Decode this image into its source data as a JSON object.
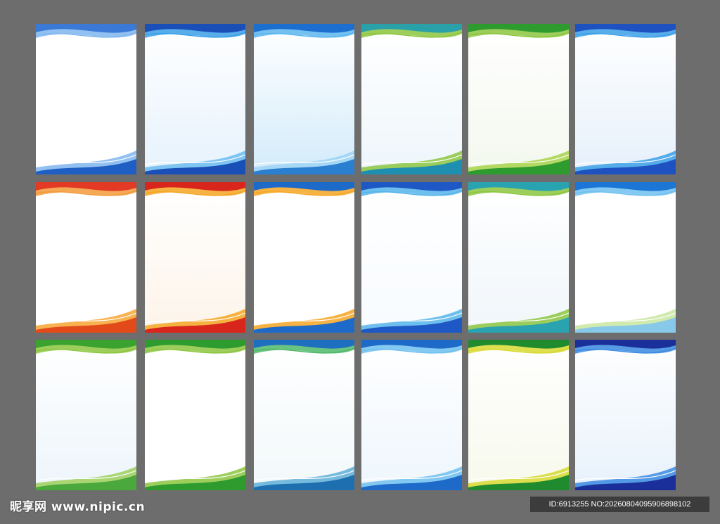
{
  "watermark": {
    "text": "昵享网 www.nipic.cn"
  },
  "id_label": {
    "text": "ID:6913255 NO:20260804095906898102"
  },
  "templates": [
    {
      "top": "#3a7ad6",
      "top2": "#7fb6ee",
      "bottom": "#1f5fc4",
      "bottom2": "#7fb6ee",
      "bg": "#ffffff"
    },
    {
      "top": "#1a4fb8",
      "top2": "#3aa0e8",
      "bottom": "#1a4fb8",
      "bottom2": "#6bbcf0",
      "bg": "#e6f2fc"
    },
    {
      "top": "#1d6fcf",
      "top2": "#5cb6ee",
      "bottom": "#2a7fd0",
      "bottom2": "#9ed3f5",
      "bg": "#d3ebfa"
    },
    {
      "top": "#2aa0a8",
      "top2": "#8cc63f",
      "bottom": "#1e8fb0",
      "bottom2": "#8cc63f",
      "bg": "#eef6fb"
    },
    {
      "top": "#2e9b2e",
      "top2": "#8cc63f",
      "bottom": "#2e9b2e",
      "bottom2": "#a7d44a",
      "bg": "#f3f8ee"
    },
    {
      "top": "#1e52c0",
      "top2": "#3aa0e8",
      "bottom": "#1e52c0",
      "bottom2": "#3aa0e8",
      "bg": "#e6f0fb"
    },
    {
      "top": "#e23a24",
      "top2": "#f39a3a",
      "bottom": "#e24a1a",
      "bottom2": "#f7a531",
      "bg": "#ffffff"
    },
    {
      "top": "#d8261c",
      "top2": "#f5a623",
      "bottom": "#d8261c",
      "bottom2": "#f5a623",
      "bg": "#fdf4ea"
    },
    {
      "top": "#1d6ac9",
      "top2": "#f5a623",
      "bottom": "#1d6ac9",
      "bottom2": "#f5a623",
      "bg": "#ffffff"
    },
    {
      "top": "#1e58c4",
      "top2": "#55b4ea",
      "bottom": "#1e58c4",
      "bottom2": "#55b4ea",
      "bg": "#f7fbff"
    },
    {
      "top": "#2aa3b0",
      "top2": "#8cc63f",
      "bottom": "#2aa3b0",
      "bottom2": "#8cc63f",
      "bg": "#f0f6fa"
    },
    {
      "top": "#1b76d6",
      "top2": "#6ec0ef",
      "bottom": "#88c8e8",
      "bottom2": "#c9e6a0",
      "bg": "#ffffff"
    },
    {
      "top": "#3aa22e",
      "top2": "#8cc63f",
      "bottom": "#4aa83c",
      "bottom2": "#9ccf5a",
      "bg": "#edf5fb"
    },
    {
      "top": "#2e9b2e",
      "top2": "#8cc63f",
      "bottom": "#2e9b2e",
      "bottom2": "#8cc63f",
      "bg": "#ffffff"
    },
    {
      "top": "#1e6fc0",
      "top2": "#4fb86b",
      "bottom": "#1e6fb0",
      "bottom2": "#5fb0d8",
      "bg": "#f2f8fa"
    },
    {
      "top": "#1d6ac9",
      "top2": "#6ec0ef",
      "bottom": "#1d6ac9",
      "bottom2": "#6ec0ef",
      "bg": "#eef6fd"
    },
    {
      "top": "#208a2e",
      "top2": "#d7d930",
      "bottom": "#208a2e",
      "bottom2": "#d7d930",
      "bg": "#f7f9ec"
    },
    {
      "top": "#1a2f9a",
      "top2": "#3a8ae0",
      "bottom": "#1a2f9a",
      "bottom2": "#3a8ae0",
      "bg": "#e7f1fb"
    }
  ]
}
